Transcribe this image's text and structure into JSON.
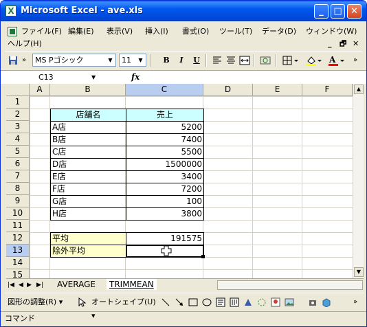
{
  "window": {
    "title": "Microsoft Excel - ave.xls",
    "app_icon": "X",
    "buttons": {
      "minimize": "_",
      "maximize": "□",
      "close": "✕"
    }
  },
  "menu": {
    "items": [
      "ファイル(F)",
      "編集(E)",
      "表示(V)",
      "挿入(I)",
      "書式(O)",
      "ツール(T)",
      "データ(D)",
      "ウィンドウ(W)"
    ],
    "help": "ヘルプ(H)",
    "doc_buttons": {
      "minimize": "_",
      "restore": "🗗",
      "close": "✕"
    }
  },
  "toolbar": {
    "font_name": "MS Pゴシック",
    "font_size": "11",
    "bold": "B",
    "italic": "I",
    "underline": "U",
    "overflow": "»"
  },
  "formula_bar": {
    "name_box": "C13",
    "fx": "fx",
    "formula": ""
  },
  "grid": {
    "columns": [
      "A",
      "B",
      "C",
      "D",
      "E",
      "F"
    ],
    "selected_column": "C",
    "rows": [
      "1",
      "2",
      "3",
      "4",
      "5",
      "6",
      "7",
      "8",
      "9",
      "10",
      "11",
      "12",
      "13",
      "14",
      "15"
    ],
    "selected_row": "13",
    "header": {
      "store": "店舗名",
      "sales": "売上"
    },
    "data": [
      {
        "store": "A店",
        "sales": "5200"
      },
      {
        "store": "B店",
        "sales": "7400"
      },
      {
        "store": "C店",
        "sales": "5500"
      },
      {
        "store": "D店",
        "sales": "1500000"
      },
      {
        "store": "E店",
        "sales": "3400"
      },
      {
        "store": "F店",
        "sales": "7200"
      },
      {
        "store": "G店",
        "sales": "100"
      },
      {
        "store": "H店",
        "sales": "3800"
      }
    ],
    "average_label": "平均",
    "average_value": "191575",
    "trimmed_label": "除外平均",
    "trimmed_value": "",
    "colors": {
      "header_fill": "#ccffff",
      "label_fill": "#ffffcc",
      "selection_header": "#b9cdf0"
    }
  },
  "sheets": {
    "tabs": [
      "AVERAGE",
      "TRIMMEAN"
    ],
    "active": "TRIMMEAN"
  },
  "drawing_toolbar": {
    "adjust": "図形の調整(R) ▾",
    "autoshapes": "オートシェイプ(U) ▾"
  },
  "status": {
    "text": "コマンド"
  }
}
